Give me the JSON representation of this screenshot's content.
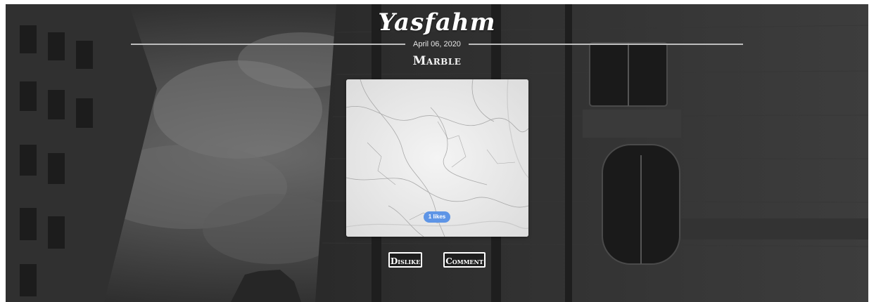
{
  "site": {
    "brand": "Yasfahm"
  },
  "post": {
    "date": "April 06, 2020",
    "title": "Marble",
    "likes_label": "1 likes",
    "image_alt": "marble texture"
  },
  "actions": {
    "dislike_label": "Dislike",
    "comment_label": "Comment"
  },
  "colors": {
    "likes_badge": "#5e95e6",
    "button_border": "#ffffff",
    "rule": "#bdbdbd"
  }
}
